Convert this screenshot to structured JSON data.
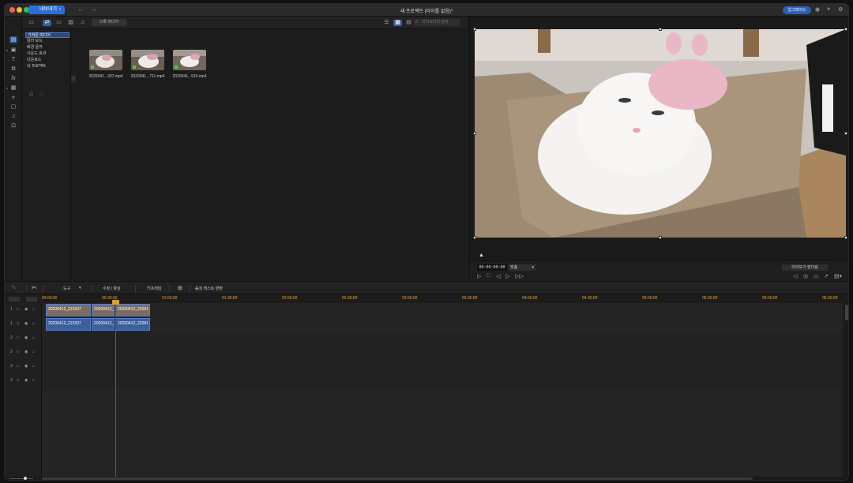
{
  "titlebar": {
    "export_label": "내보내기",
    "title": "새 프로젝트 (타이틀 없음)*",
    "upgrade_label": "업그레이드"
  },
  "library": {
    "stock_button": "스톡 미디어",
    "search_placeholder": "라이브러리 검색",
    "categories": [
      "가져온 미디어",
      "컬러 보드",
      "배경 음악",
      "사운드 효과",
      "다운로드",
      "내 프로젝트"
    ],
    "media": [
      {
        "name": "2020041...337.mp4"
      },
      {
        "name": "2020041...711.mp4"
      },
      {
        "name": "2020041...916.mp4"
      }
    ]
  },
  "preview": {
    "timecode": "00:00:00:00",
    "fit_label": "맞춤",
    "render_label": "미리보기 렌더링"
  },
  "timeline_toolbar": {
    "tools_label": "도구",
    "edit_label": "수정 / 향상",
    "keyframe_label": "키프레임",
    "speech_label": "음성 텍스트 변환"
  },
  "ruler": {
    "labels": [
      "00:00:00",
      "00:30:00",
      "01:00:00",
      "01:30:00",
      "02:00:00",
      "02:30:00",
      "03:00:00",
      "03:30:00",
      "04:00:00",
      "04:30:00",
      "05:00:00",
      "05:30:00",
      "06:00:00",
      "06:30:00"
    ]
  },
  "tracks": [
    {
      "num": "1",
      "type": "video"
    },
    {
      "num": "1",
      "type": "audio"
    },
    {
      "num": "2",
      "type": "video"
    },
    {
      "num": "2",
      "type": "audio"
    },
    {
      "num": "3",
      "type": "video"
    },
    {
      "num": "3",
      "type": "audio"
    }
  ],
  "clips": {
    "video": [
      "20200412_215337",
      "20200412_2",
      "20200412_22091"
    ],
    "audio": [
      "20200412_215337",
      "20200412_",
      "20200412_22091"
    ]
  },
  "colors": {
    "accent": "#2d6fd6",
    "playhead": "#c0392b",
    "ruler_text": "#e0a540"
  }
}
